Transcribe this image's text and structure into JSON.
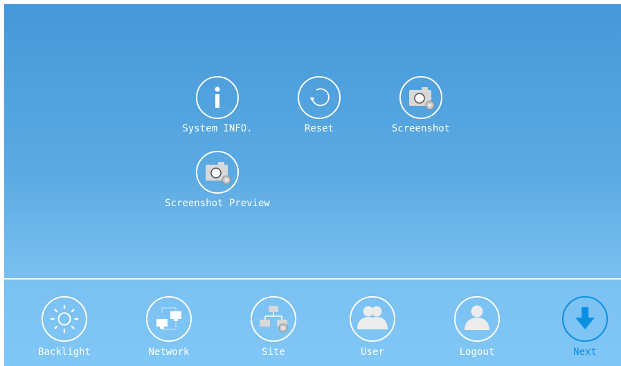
{
  "menu": {
    "items": [
      {
        "label": "System INFO.",
        "icon": "info-icon"
      },
      {
        "label": "Reset",
        "icon": "reset-icon"
      },
      {
        "label": "Screenshot",
        "icon": "camera-icon"
      },
      {
        "label": "Screenshot Preview",
        "icon": "camera-preview-icon"
      }
    ]
  },
  "dock": {
    "items": [
      {
        "label": "Backlight",
        "icon": "sun-icon"
      },
      {
        "label": "Network",
        "icon": "network-icon"
      },
      {
        "label": "Site",
        "icon": "site-icon"
      },
      {
        "label": "User",
        "icon": "users-icon"
      },
      {
        "label": "Logout",
        "icon": "user-icon"
      },
      {
        "label": "Next",
        "icon": "arrow-down-icon"
      }
    ]
  },
  "colors": {
    "background_top": "#4598d8",
    "background_bottom": "#80c6f6",
    "icon_white": "#ffffff",
    "next_accent": "#0b8fe3"
  }
}
